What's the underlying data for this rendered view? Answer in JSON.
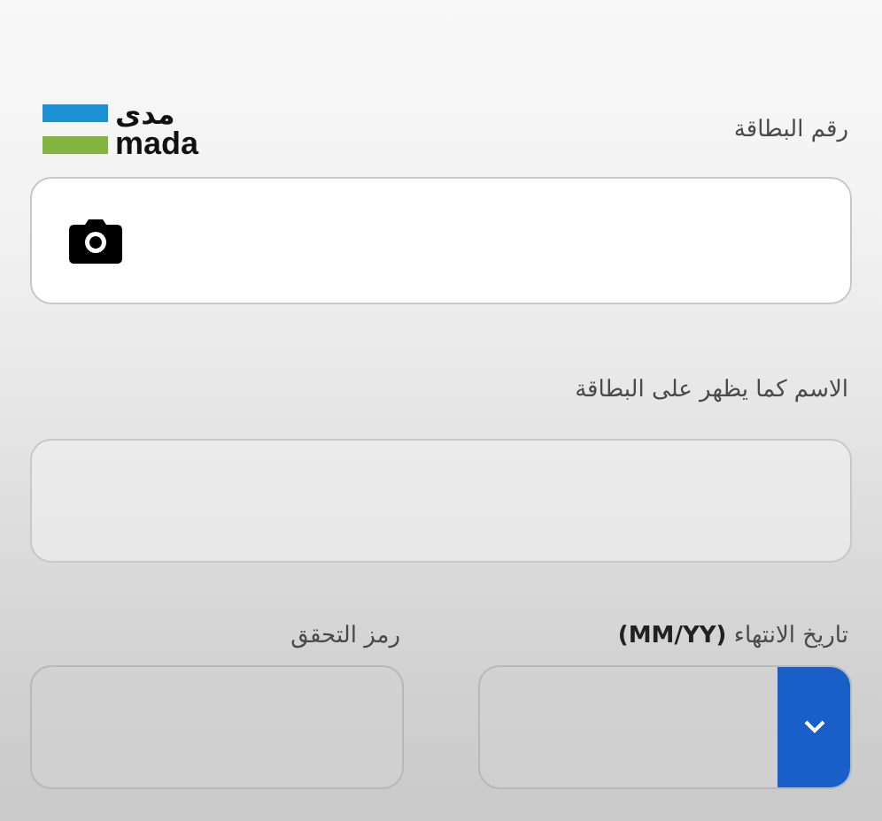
{
  "logo": {
    "arabic": "مدى",
    "latin": "mada"
  },
  "card_number": {
    "label": "رقم البطاقة"
  },
  "cardholder_name": {
    "label": "الاسم كما يظهر على البطاقة"
  },
  "expiry": {
    "label": "تاريخ الانتهاء **(MM/YY)**"
  },
  "cvv": {
    "label": "رمز التحقق"
  }
}
